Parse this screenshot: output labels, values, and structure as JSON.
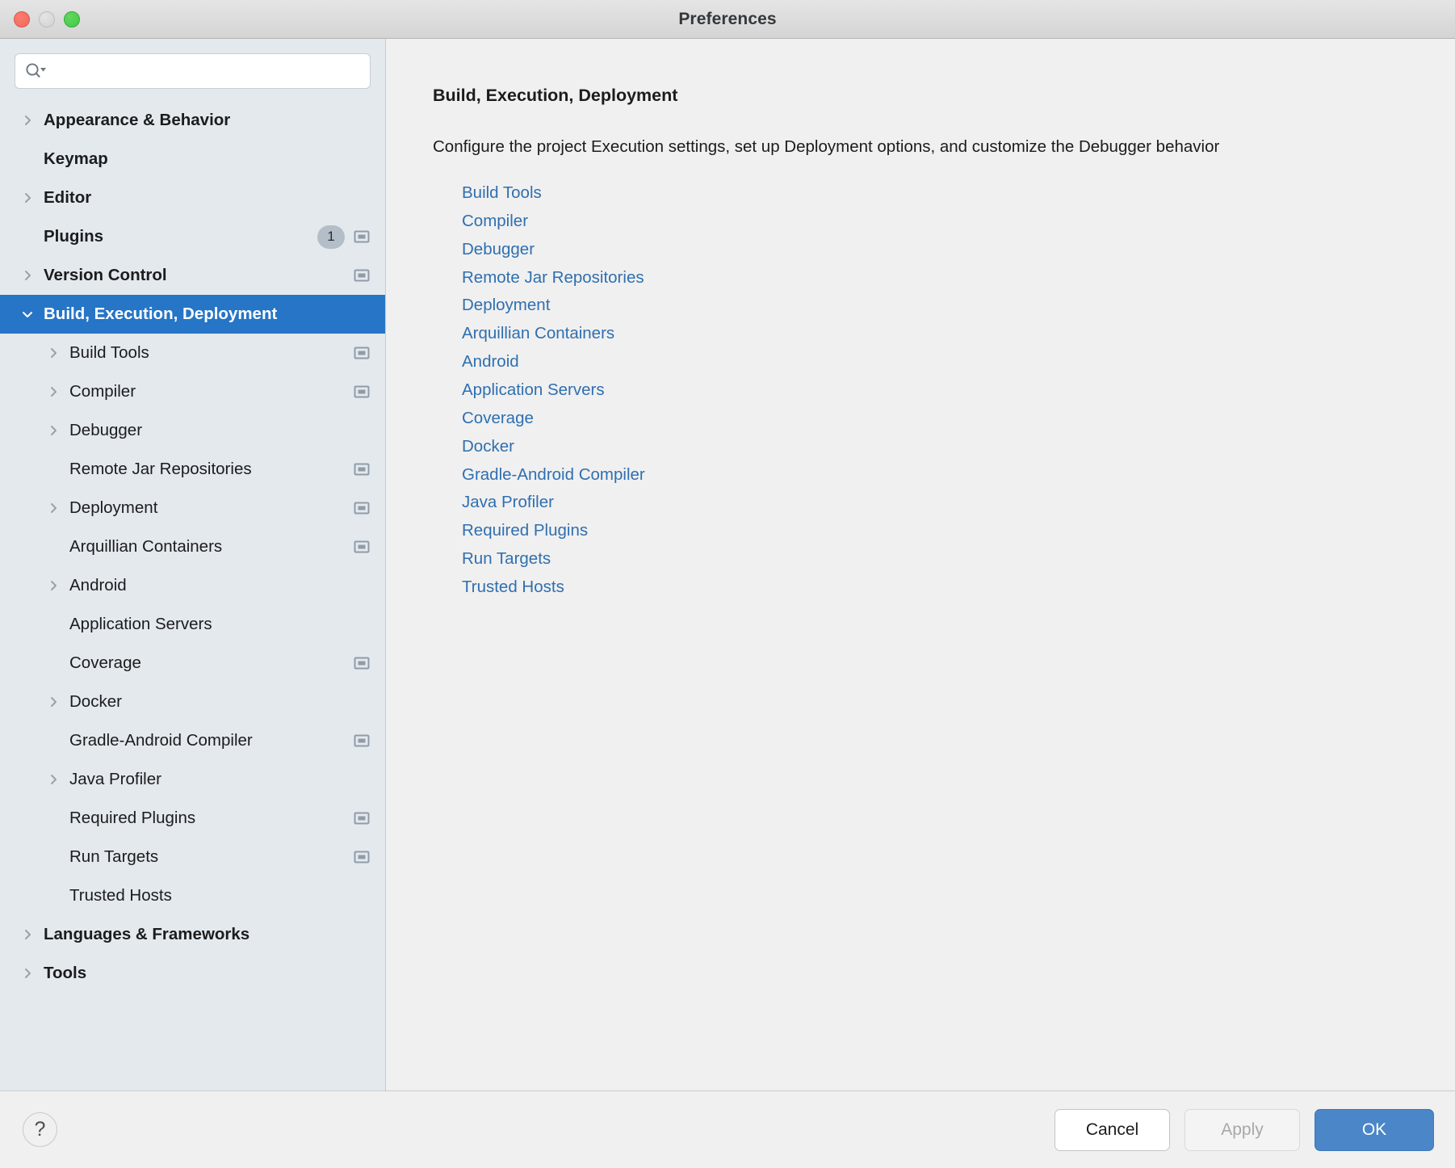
{
  "window": {
    "title": "Preferences",
    "traffic_lights": [
      "close",
      "minimize",
      "zoom"
    ]
  },
  "search": {
    "value": "",
    "placeholder": "",
    "icon": "search-icon"
  },
  "sidebar": {
    "items": [
      {
        "label": "Appearance & Behavior",
        "level": "top",
        "expandable": true,
        "expanded": false,
        "selected": false,
        "badge": null,
        "project_icon": false
      },
      {
        "label": "Keymap",
        "level": "top",
        "expandable": false,
        "expanded": false,
        "selected": false,
        "badge": null,
        "project_icon": false
      },
      {
        "label": "Editor",
        "level": "top",
        "expandable": true,
        "expanded": false,
        "selected": false,
        "badge": null,
        "project_icon": false
      },
      {
        "label": "Plugins",
        "level": "top",
        "expandable": false,
        "expanded": false,
        "selected": false,
        "badge": "1",
        "project_icon": true
      },
      {
        "label": "Version Control",
        "level": "top",
        "expandable": true,
        "expanded": false,
        "selected": false,
        "badge": null,
        "project_icon": true
      },
      {
        "label": "Build, Execution, Deployment",
        "level": "top",
        "expandable": true,
        "expanded": true,
        "selected": true,
        "badge": null,
        "project_icon": false
      },
      {
        "label": "Build Tools",
        "level": "sub",
        "expandable": true,
        "expanded": false,
        "selected": false,
        "badge": null,
        "project_icon": true
      },
      {
        "label": "Compiler",
        "level": "sub",
        "expandable": true,
        "expanded": false,
        "selected": false,
        "badge": null,
        "project_icon": true
      },
      {
        "label": "Debugger",
        "level": "sub",
        "expandable": true,
        "expanded": false,
        "selected": false,
        "badge": null,
        "project_icon": false
      },
      {
        "label": "Remote Jar Repositories",
        "level": "sub",
        "expandable": false,
        "expanded": false,
        "selected": false,
        "badge": null,
        "project_icon": true
      },
      {
        "label": "Deployment",
        "level": "sub",
        "expandable": true,
        "expanded": false,
        "selected": false,
        "badge": null,
        "project_icon": true
      },
      {
        "label": "Arquillian Containers",
        "level": "sub",
        "expandable": false,
        "expanded": false,
        "selected": false,
        "badge": null,
        "project_icon": true
      },
      {
        "label": "Android",
        "level": "sub",
        "expandable": true,
        "expanded": false,
        "selected": false,
        "badge": null,
        "project_icon": false
      },
      {
        "label": "Application Servers",
        "level": "sub",
        "expandable": false,
        "expanded": false,
        "selected": false,
        "badge": null,
        "project_icon": false
      },
      {
        "label": "Coverage",
        "level": "sub",
        "expandable": false,
        "expanded": false,
        "selected": false,
        "badge": null,
        "project_icon": true
      },
      {
        "label": "Docker",
        "level": "sub",
        "expandable": true,
        "expanded": false,
        "selected": false,
        "badge": null,
        "project_icon": false
      },
      {
        "label": "Gradle-Android Compiler",
        "level": "sub",
        "expandable": false,
        "expanded": false,
        "selected": false,
        "badge": null,
        "project_icon": true
      },
      {
        "label": "Java Profiler",
        "level": "sub",
        "expandable": true,
        "expanded": false,
        "selected": false,
        "badge": null,
        "project_icon": false
      },
      {
        "label": "Required Plugins",
        "level": "sub",
        "expandable": false,
        "expanded": false,
        "selected": false,
        "badge": null,
        "project_icon": true
      },
      {
        "label": "Run Targets",
        "level": "sub",
        "expandable": false,
        "expanded": false,
        "selected": false,
        "badge": null,
        "project_icon": true
      },
      {
        "label": "Trusted Hosts",
        "level": "sub",
        "expandable": false,
        "expanded": false,
        "selected": false,
        "badge": null,
        "project_icon": false
      },
      {
        "label": "Languages & Frameworks",
        "level": "top",
        "expandable": true,
        "expanded": false,
        "selected": false,
        "badge": null,
        "project_icon": false
      },
      {
        "label": "Tools",
        "level": "top",
        "expandable": true,
        "expanded": false,
        "selected": false,
        "badge": null,
        "project_icon": false
      }
    ]
  },
  "content": {
    "title": "Build, Execution, Deployment",
    "description": "Configure the project Execution settings, set up Deployment options, and customize the Debugger behavior",
    "link_color": "#2f6fb0",
    "links": [
      "Build Tools",
      "Compiler",
      "Debugger",
      "Remote Jar Repositories",
      "Deployment",
      "Arquillian Containers",
      "Android",
      "Application Servers",
      "Coverage",
      "Docker",
      "Gradle-Android Compiler",
      "Java Profiler",
      "Required Plugins",
      "Run Targets",
      "Trusted Hosts"
    ]
  },
  "footer": {
    "help_label": "?",
    "cancel_label": "Cancel",
    "apply_label": "Apply",
    "apply_disabled": true,
    "ok_label": "OK",
    "ok_color": "#4a86c8"
  }
}
